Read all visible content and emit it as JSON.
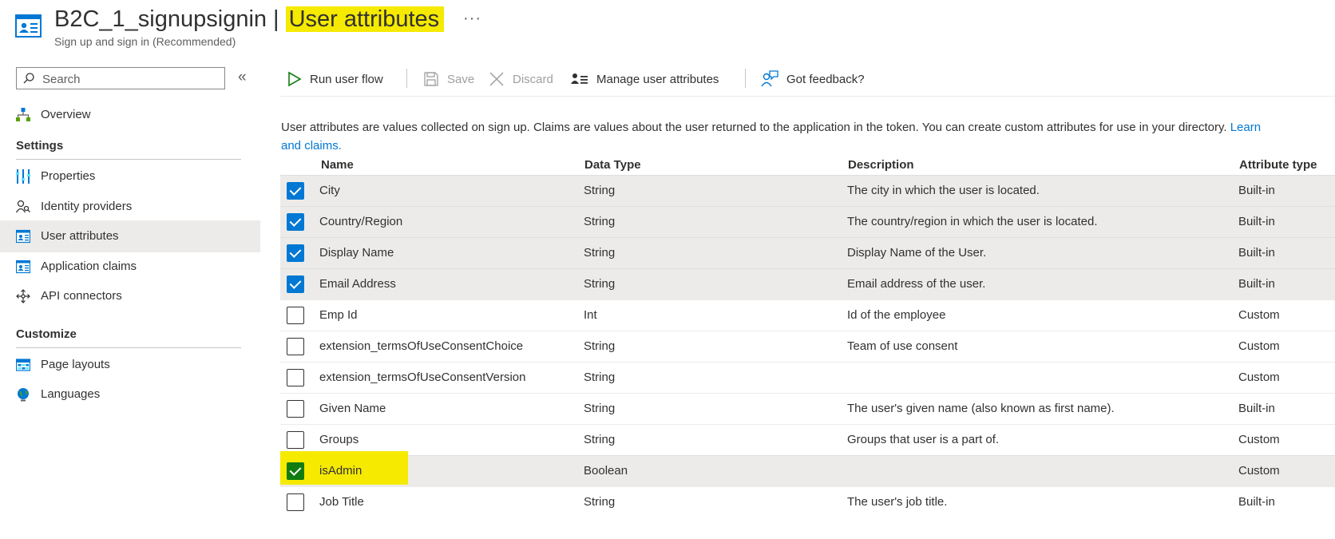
{
  "header": {
    "title_prefix": "B2C_1_signupsignin",
    "title_separator": "|",
    "title_highlight": "User attributes",
    "more": "···",
    "subtitle": "Sign up and sign in (Recommended)"
  },
  "sidebar": {
    "search_placeholder": "Search",
    "collapse": "«",
    "overview": "Overview",
    "sections": [
      {
        "title": "Settings",
        "items": [
          {
            "label": "Properties",
            "icon": "properties-icon"
          },
          {
            "label": "Identity providers",
            "icon": "identity-providers-icon"
          },
          {
            "label": "User attributes",
            "icon": "user-attributes-icon",
            "active": true
          },
          {
            "label": "Application claims",
            "icon": "application-claims-icon"
          },
          {
            "label": "API connectors",
            "icon": "api-connectors-icon"
          }
        ]
      },
      {
        "title": "Customize",
        "items": [
          {
            "label": "Page layouts",
            "icon": "page-layouts-icon"
          },
          {
            "label": "Languages",
            "icon": "languages-icon"
          }
        ]
      }
    ]
  },
  "toolbar": {
    "run": "Run user flow",
    "save": "Save",
    "discard": "Discard",
    "manage": "Manage user attributes",
    "feedback": "Got feedback?"
  },
  "description": {
    "text": "User attributes are values collected on sign up. Claims are values about the user returned to the application in the token. You can create custom attributes for use in your directory.",
    "link_part1": "Learn",
    "link_part2": "and claims."
  },
  "table": {
    "columns": [
      "Name",
      "Data Type",
      "Description",
      "Attribute type"
    ],
    "rows": [
      {
        "name": "City",
        "type": "String",
        "description": "The city in which the user is located.",
        "attr": "Built-in",
        "checked": true
      },
      {
        "name": "Country/Region",
        "type": "String",
        "description": "The country/region in which the user is located.",
        "attr": "Built-in",
        "checked": true
      },
      {
        "name": "Display Name",
        "type": "String",
        "description": "Display Name of the User.",
        "attr": "Built-in",
        "checked": true
      },
      {
        "name": "Email Address",
        "type": "String",
        "description": "Email address of the user.",
        "attr": "Built-in",
        "checked": true
      },
      {
        "name": "Emp Id",
        "type": "Int",
        "description": "Id of the employee",
        "attr": "Custom",
        "checked": false
      },
      {
        "name": "extension_termsOfUseConsentChoice",
        "type": "String",
        "description": "Team of use consent",
        "attr": "Custom",
        "checked": false
      },
      {
        "name": "extension_termsOfUseConsentVersion",
        "type": "String",
        "description": "",
        "attr": "Custom",
        "checked": false
      },
      {
        "name": "Given Name",
        "type": "String",
        "description": "The user's given name (also known as first name).",
        "attr": "Built-in",
        "checked": false
      },
      {
        "name": "Groups",
        "type": "String",
        "description": "Groups that user is a part of.",
        "attr": "Custom",
        "checked": false
      },
      {
        "name": "isAdmin",
        "type": "Boolean",
        "description": "",
        "attr": "Custom",
        "checked": true,
        "highlighted": true
      },
      {
        "name": "Job Title",
        "type": "String",
        "description": "The user's job title.",
        "attr": "Built-in",
        "checked": false
      }
    ]
  },
  "colors": {
    "accent": "#0078d4",
    "highlight": "#f5ea00",
    "selected_row": "#edebe9",
    "admin_check": "#107c10"
  }
}
